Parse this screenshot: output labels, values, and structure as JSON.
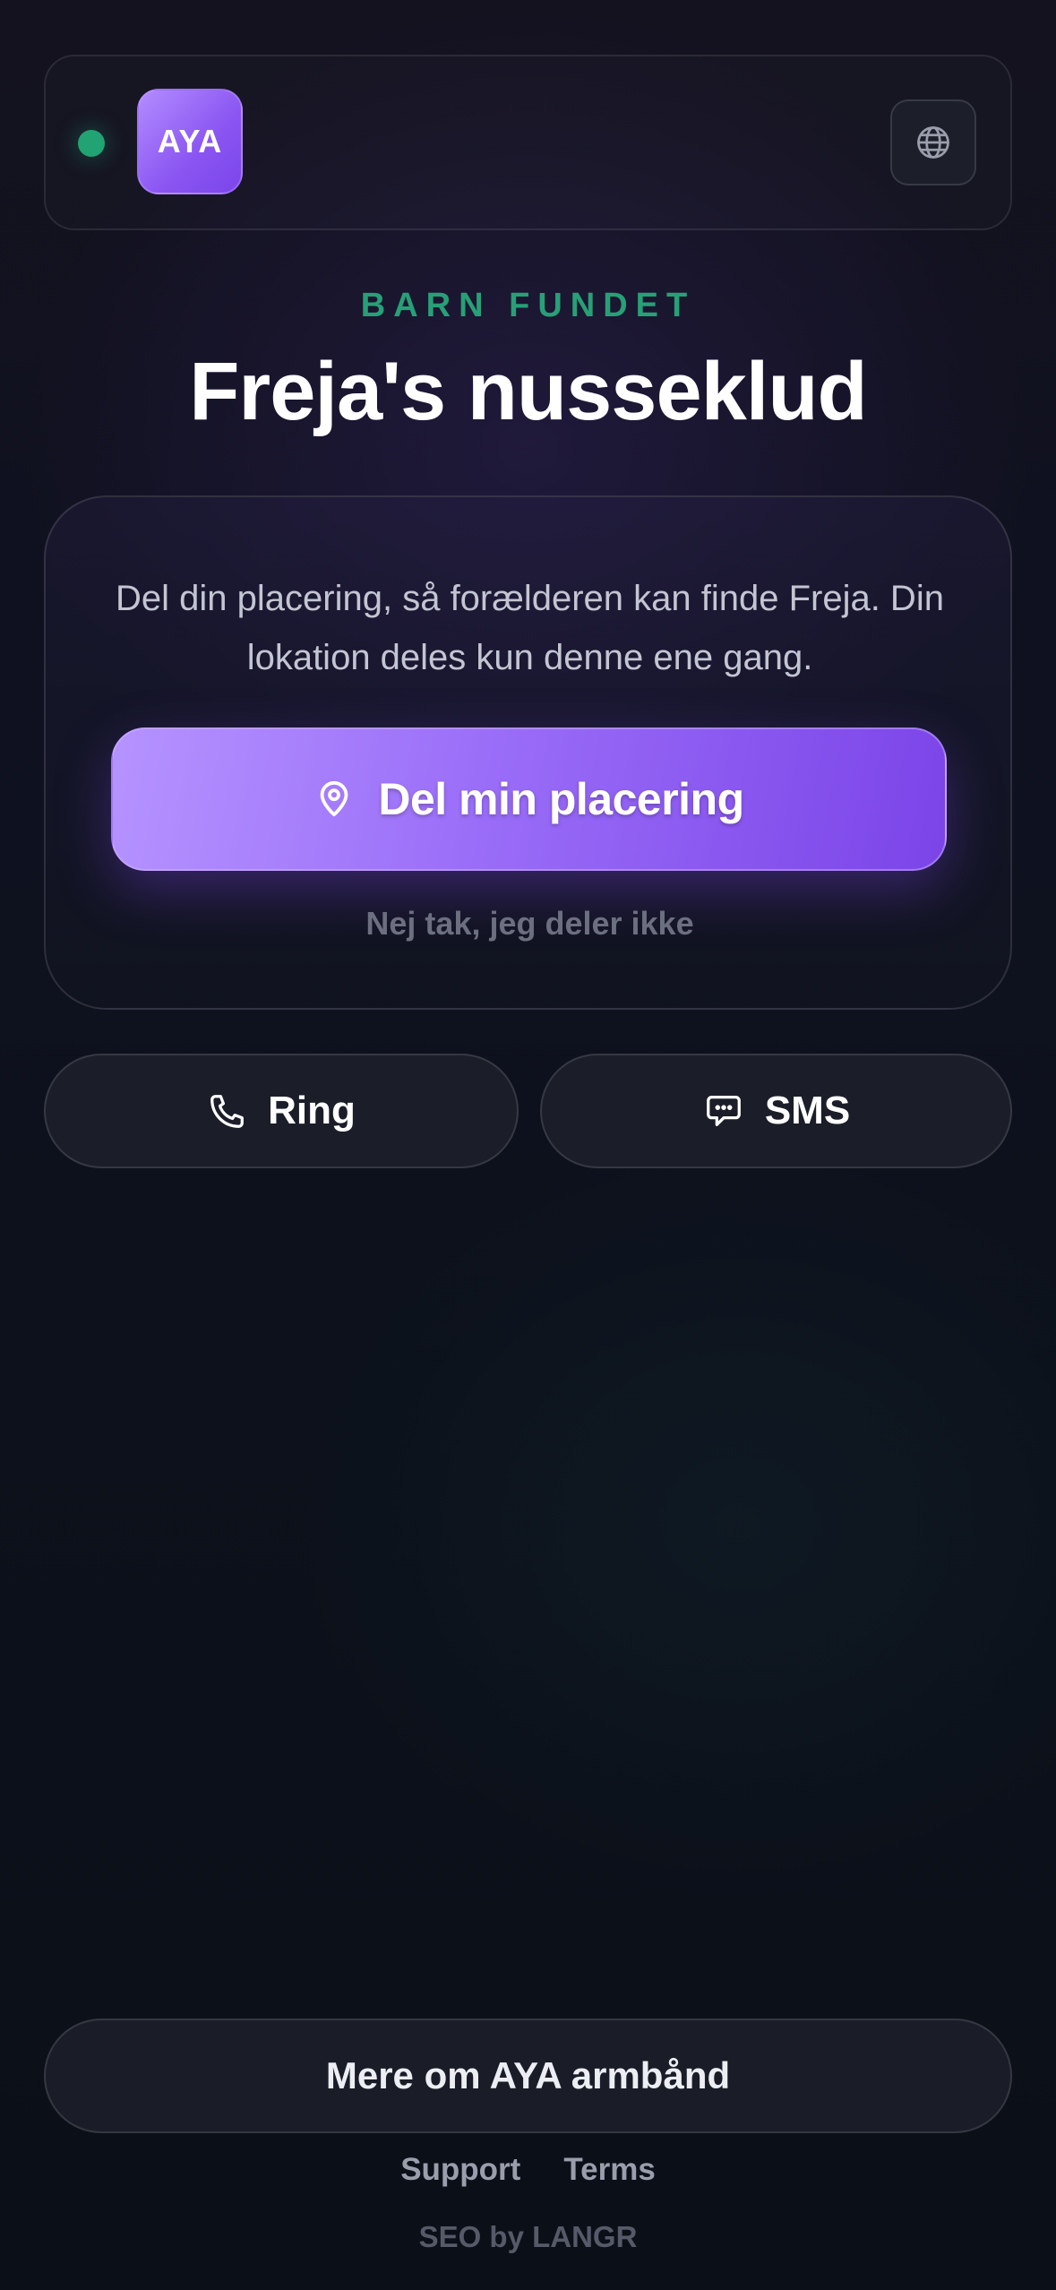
{
  "header": {
    "logo_text": "AYA",
    "status_color": "#22a373",
    "language_icon": "globe-icon"
  },
  "hero": {
    "eyebrow": "BARN FUNDET",
    "title": "Freja's nusseklud"
  },
  "share_card": {
    "description": "Del din placering, så forælderen kan finde Freja. Din lokation deles kun denne ene gang.",
    "share_label": "Del min placering",
    "share_icon": "location-pin-icon",
    "decline_label": "Nej tak, jeg deler ikke"
  },
  "contact": {
    "call_label": "Ring",
    "call_icon": "phone-icon",
    "sms_label": "SMS",
    "sms_icon": "chat-bubble-icon"
  },
  "footer": {
    "more_label": "Mere om AYA armbånd",
    "support_label": "Support",
    "terms_label": "Terms",
    "credit": "SEO by LANGR"
  },
  "colors": {
    "accent": "#8a55f2",
    "success": "#27a077",
    "background": "#0f1120"
  }
}
